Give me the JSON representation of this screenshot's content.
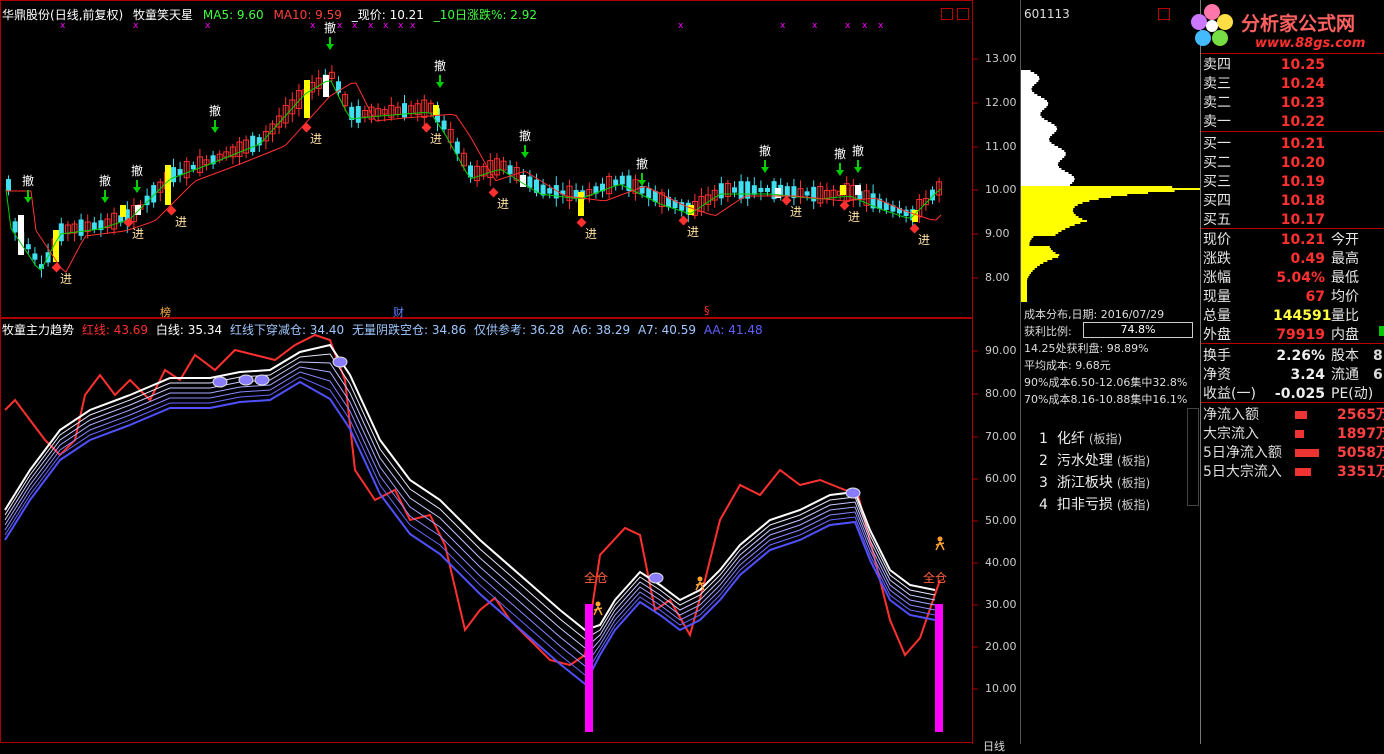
{
  "main_header": {
    "stock": "华鼎股份",
    "mode": "(日线,前复权)",
    "indicator": "牧童笑天星",
    "ma5": "MA5: 9.60",
    "ma10": "MA10: 9.59",
    "price": "_现价: 10.21",
    "change": "_10日涨跌%: 2.92"
  },
  "sub_header": {
    "name": "牧童主力趋势",
    "red": "红线: 43.69",
    "white": "白线: 35.34",
    "cross": "红线下穿减仓: 34.40",
    "yin": "无量阴跌空仓: 34.86",
    "ref": "仅供参考: 36.28",
    "a6": "A6: 38.29",
    "a7": "A7: 40.59",
    "aa": "AA: 41.48"
  },
  "markers": {
    "withdraw": "撤",
    "enter": "进",
    "full": "全仓",
    "bang": "榜",
    "cai": "财",
    "s": "§"
  },
  "price_axis": [
    "13.00",
    "12.00",
    "11.00",
    "10.00",
    "9.00",
    "8.00"
  ],
  "ind_axis": [
    "90.00",
    "80.00",
    "70.00",
    "60.00",
    "50.00",
    "40.00",
    "30.00",
    "20.00",
    "10.00"
  ],
  "side": {
    "code": "601113",
    "cost_date": "成本分布,日期: 2016/07/29",
    "profit_ratio_label": "获利比例:",
    "profit_ratio": "74.8%",
    "profit_line": "14.25处获利盘: 98.89%",
    "avg_cost": "平均成本: 9.68元",
    "c90": "90%成本6.50-12.06集中32.8%",
    "c70": "70%成本8.16-10.88集中16.1%",
    "axis_label": "日线"
  },
  "sectors": [
    {
      "n": "1",
      "name": "化纤",
      "tag": "(板指)"
    },
    {
      "n": "2",
      "name": "污水处理",
      "tag": "(板指)"
    },
    {
      "n": "3",
      "name": "浙江板块",
      "tag": "(板指)"
    },
    {
      "n": "4",
      "name": "扣非亏损",
      "tag": "(板指)"
    }
  ],
  "logo": {
    "title": "分析家公式网",
    "url": "www.88gs.com"
  },
  "quote": {
    "asks": [
      {
        "k": "卖四",
        "v": "10.25"
      },
      {
        "k": "卖三",
        "v": "10.24"
      },
      {
        "k": "卖二",
        "v": "10.23"
      },
      {
        "k": "卖一",
        "v": "10.22"
      }
    ],
    "bids": [
      {
        "k": "买一",
        "v": "10.21"
      },
      {
        "k": "买二",
        "v": "10.20"
      },
      {
        "k": "买三",
        "v": "10.19"
      },
      {
        "k": "买四",
        "v": "10.18"
      },
      {
        "k": "买五",
        "v": "10.17"
      }
    ],
    "stats": [
      {
        "k": "现价",
        "v": "10.21",
        "c": "#ff3030",
        "k2": "今开"
      },
      {
        "k": "涨跌",
        "v": "0.49",
        "c": "#ff3030",
        "k2": "最高"
      },
      {
        "k": "涨幅",
        "v": "5.04%",
        "c": "#ff3030",
        "k2": "最低"
      },
      {
        "k": "现量",
        "v": "67",
        "c": "#ff3030",
        "k2": "均价"
      },
      {
        "k": "总量",
        "v": "144591",
        "c": "#ffff40",
        "k2": "量比"
      },
      {
        "k": "外盘",
        "v": "79919",
        "c": "#ff3030",
        "k2": "内盘"
      }
    ],
    "finance": [
      {
        "k": "换手",
        "v": "2.26%",
        "k2": "股本",
        "v2": "8"
      },
      {
        "k": "净资",
        "v": "3.24",
        "k2": "流通",
        "v2": "6"
      },
      {
        "k": "收益(一)",
        "v": "-0.025",
        "k2": "PE(动)",
        "v2": ""
      }
    ],
    "flows": [
      {
        "k": "净流入额",
        "v": "2565万",
        "bar": 0.25
      },
      {
        "k": "大宗流入",
        "v": "1897万",
        "bar": 0.19
      },
      {
        "k": "5日净流入额",
        "v": "5058万",
        "bar": 0.5
      },
      {
        "k": "5日大宗流入",
        "v": "3351万",
        "bar": 0.33
      }
    ]
  },
  "colors": {
    "up": "#ff3030",
    "down": "#40e0f0",
    "yellow": "#ffff00",
    "white": "#ffffff",
    "blue": "#5050ff",
    "magenta": "#ff00ff",
    "green": "#00d000"
  }
}
